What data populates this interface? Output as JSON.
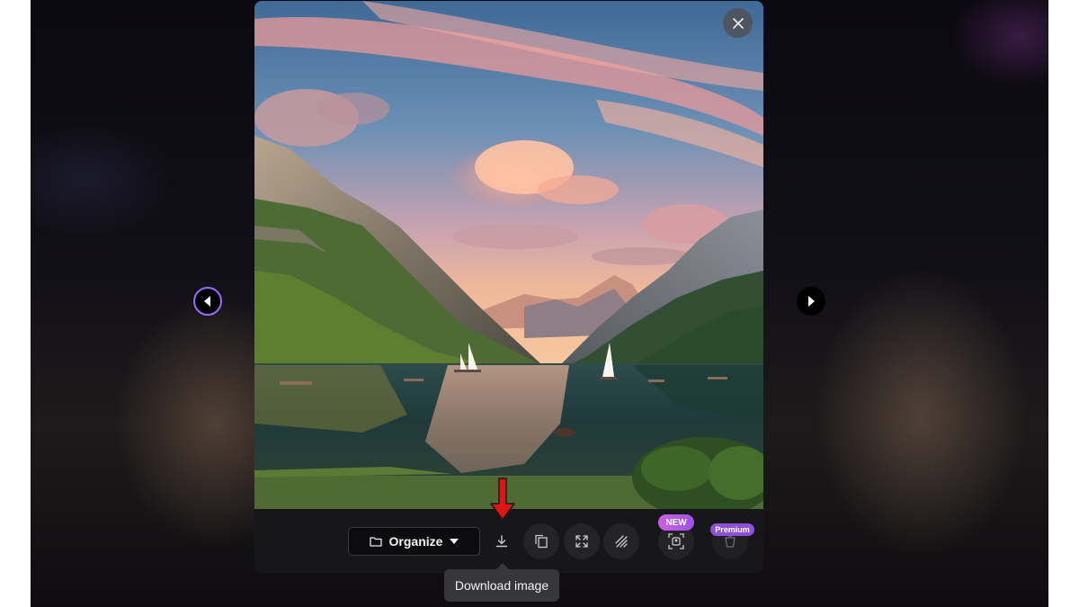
{
  "viewer": {
    "close_icon": "close-icon",
    "prev_icon": "chevron-left-icon",
    "next_icon": "chevron-right-icon",
    "image": {
      "subject": "mountain-lake-sunset-photo"
    }
  },
  "toolbar": {
    "organize_label": "Organize",
    "organize_icon": "folder-icon",
    "organize_caret": "caret-down-icon",
    "tools": [
      {
        "name": "download",
        "icon": "download-icon"
      },
      {
        "name": "copy",
        "icon": "copy-icon"
      },
      {
        "name": "expand",
        "icon": "expand-icon"
      },
      {
        "name": "remove-background",
        "icon": "hatch-icon"
      },
      {
        "name": "scan",
        "icon": "scan-icon"
      },
      {
        "name": "premium-tool",
        "icon": "cup-icon"
      }
    ],
    "new_badge": "NEW",
    "premium_badge": "Premium"
  },
  "tooltip": {
    "text": "Download image"
  },
  "annotation": {
    "arrow_color": "#e11414"
  },
  "colors": {
    "accent": "#9a6cff",
    "new_badge": "#c55ee6",
    "premium_badge": "#8e4fd9"
  }
}
